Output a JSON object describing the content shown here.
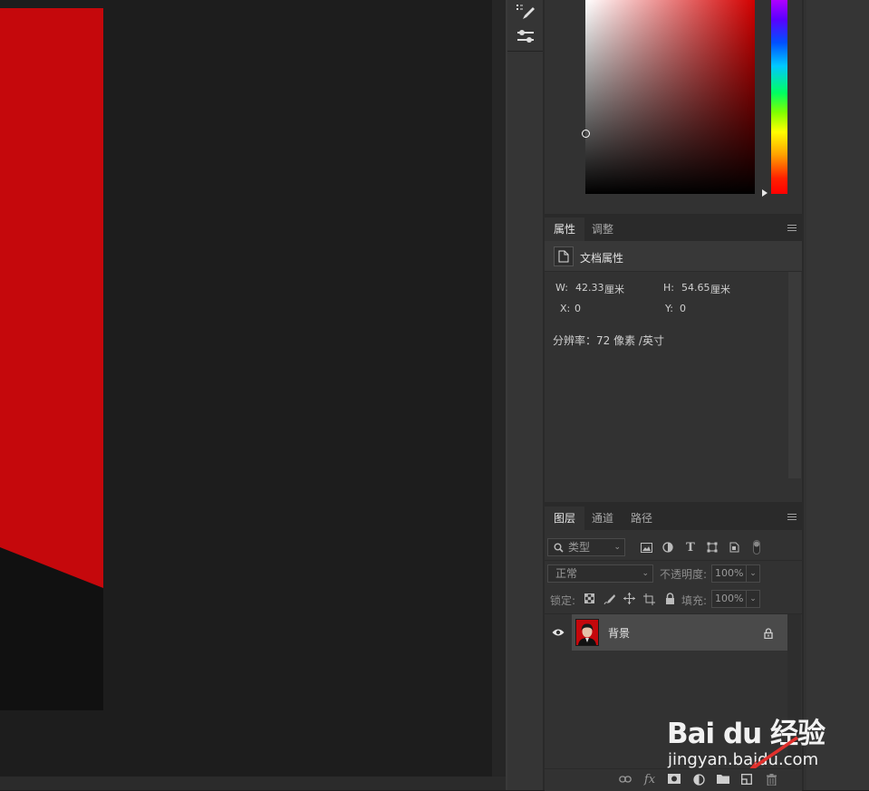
{
  "colors": {
    "document_red": "#c5080c",
    "panel_bg": "#323232",
    "selected_layer_bg": "#4a4a4a",
    "accent_arrow": "#e0302c"
  },
  "properties_panel": {
    "tabs": [
      {
        "label": "属性",
        "active": true
      },
      {
        "label": "调整",
        "active": false
      }
    ],
    "section_title": "文档属性",
    "width_label": "W:",
    "width_value": "42.33",
    "width_unit": "厘米",
    "height_label": "H:",
    "height_value": "54.65",
    "height_unit": "厘米",
    "x_label": "X:",
    "x_value": "0",
    "y_label": "Y:",
    "y_value": "0",
    "resolution_text": "分辨率：72 像素 /英寸"
  },
  "layers_panel": {
    "tabs": [
      {
        "label": "图层",
        "active": true
      },
      {
        "label": "通道",
        "active": false
      },
      {
        "label": "路径",
        "active": false
      }
    ],
    "filter_kind": "类型",
    "blend_mode": "正常",
    "opacity_label": "不透明度:",
    "opacity_value": "100%",
    "lock_label": "锁定:",
    "fill_label": "填充:",
    "fill_value": "100%",
    "layers": [
      {
        "name": "背景",
        "visible": true,
        "locked": true
      }
    ],
    "footer_icons": [
      "link-icon",
      "fx-icon",
      "mask-icon",
      "adjustment-icon",
      "folder-icon",
      "new-layer-icon",
      "trash-icon"
    ],
    "fx_label": "fx"
  },
  "watermark": {
    "logo_text": "Bai du 经验",
    "url": "jingyan.baidu.com"
  }
}
